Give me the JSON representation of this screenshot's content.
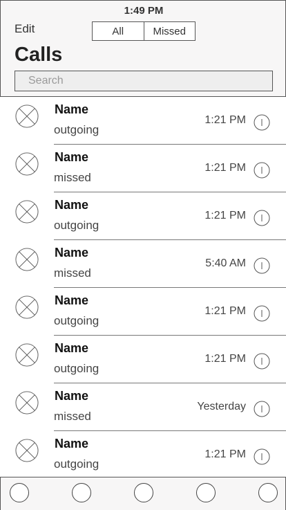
{
  "status_bar": {
    "time": "1:49 PM"
  },
  "header": {
    "edit_label": "Edit",
    "segments": [
      "All",
      "Missed"
    ],
    "title": "Calls",
    "search_placeholder": "Search"
  },
  "calls": [
    {
      "name": "Name",
      "type": "outgoing",
      "time": "1:21 PM"
    },
    {
      "name": "Name",
      "type": "missed",
      "time": "1:21 PM"
    },
    {
      "name": "Name",
      "type": "outgoing",
      "time": "1:21 PM"
    },
    {
      "name": "Name",
      "type": "missed",
      "time": "5:40 AM"
    },
    {
      "name": "Name",
      "type": "outgoing",
      "time": "1:21 PM"
    },
    {
      "name": "Name",
      "type": "outgoing",
      "time": "1:21 PM"
    },
    {
      "name": "Name",
      "type": "missed",
      "time": "Yesterday"
    },
    {
      "name": "Name",
      "type": "outgoing",
      "time": "1:21 PM"
    }
  ],
  "tab_bar": {
    "tabs": [
      "tab-circle-icon",
      "tab-circle-icon",
      "tab-circle-icon",
      "tab-circle-icon",
      "tab-circle-icon"
    ]
  }
}
